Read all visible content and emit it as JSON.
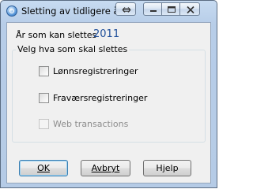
{
  "window": {
    "title": "Sletting av tidligere år"
  },
  "form": {
    "year_label": "År som kan slettes",
    "year_value": "2011",
    "group_label": "Velg hva som skal slettes",
    "options": [
      {
        "label": "Lønnsregistreringer",
        "checked": false,
        "enabled": true
      },
      {
        "label": "Fraværsregistreringer",
        "checked": false,
        "enabled": true
      },
      {
        "label": "Web transactions",
        "checked": false,
        "enabled": false
      }
    ]
  },
  "buttons": {
    "ok": "OK",
    "cancel": "Avbryt",
    "help": "Hjelp"
  },
  "icons": {
    "app": "app-globe-icon",
    "swap": "swap-arrows-icon",
    "minimize": "minimize-icon",
    "maximize": "maximize-icon",
    "close": "close-icon"
  }
}
